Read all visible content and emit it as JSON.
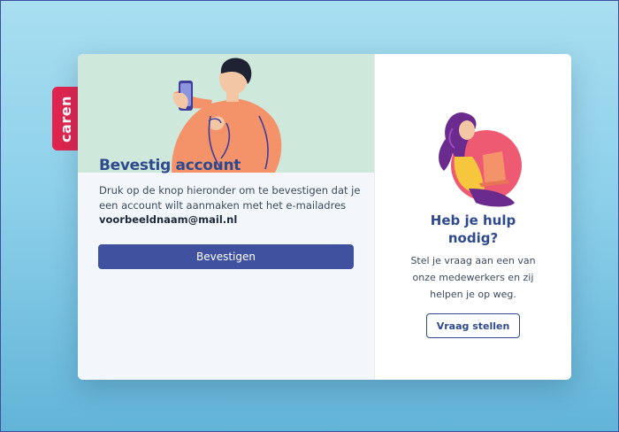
{
  "brand": {
    "name": "caren",
    "color": "#e0254f"
  },
  "confirm_panel": {
    "title": "Bevestig account",
    "description": "Druk op de knop hieronder om te bevestigen dat je een account wilt aanmaken met het e-mailadres",
    "email": "voorbeeldnaam@mail.nl",
    "button_label": "Bevestigen"
  },
  "help_panel": {
    "title_line1": "Heb je hulp",
    "title_line2": "nodig?",
    "text_line1": "Stel je vraag aan een van",
    "text_line2": "onze medewerkers en zij",
    "text_line3": "helpen je op weg.",
    "button_label": "Vraag stellen"
  },
  "colors": {
    "primary": "#4051a0",
    "heading": "#2f4a8c",
    "hero_background": "#cfe8dc",
    "illustration_orange": "#f4936a",
    "illustration_pink": "#ef5a73",
    "illustration_purple": "#6b2a8e",
    "illustration_yellow": "#f6c63c"
  },
  "icons": {
    "hero": "person-with-phone-illustration",
    "help": "woman-with-laptop-illustration"
  }
}
